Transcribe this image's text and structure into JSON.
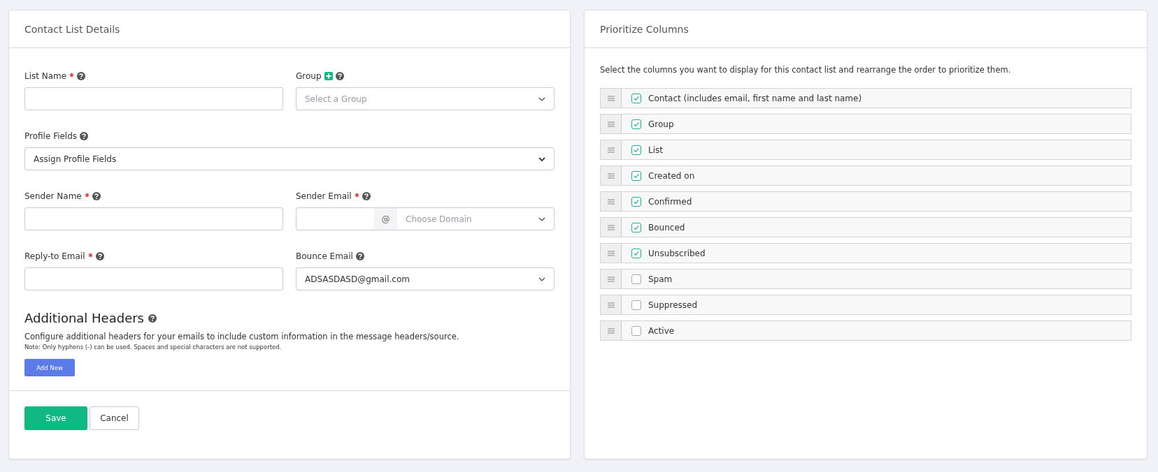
{
  "contact_list_details": {
    "title": "Contact List Details",
    "rows": [
      [
        {
          "label": "List Name",
          "required": true,
          "addable": false,
          "kind": "text"
        },
        {
          "label": "Group",
          "required": false,
          "addable": true,
          "kind": "select",
          "placeholder": "Select a Group"
        }
      ],
      [
        {
          "label": "Profile Fields",
          "required": false,
          "addable": false,
          "kind": "wide-select",
          "value": "Assign Profile Fields"
        }
      ],
      [
        {
          "label": "Sender Name",
          "required": true,
          "addable": false,
          "kind": "text"
        },
        {
          "label": "Sender Email",
          "required": true,
          "addable": false,
          "kind": "email-domain",
          "at": "@",
          "placeholder": "Choose Domain"
        }
      ],
      [
        {
          "label": "Reply-to Email",
          "required": true,
          "addable": false,
          "kind": "text"
        },
        {
          "label": "Bounce Email",
          "required": false,
          "addable": false,
          "kind": "select",
          "value": "ADSASDASD@gmail.com"
        }
      ]
    ],
    "additional_headers": {
      "title": "Additional Headers",
      "description": "Configure additional headers for your emails to include custom information in the message headers/source.",
      "note": "Note: Only hyphens (-) can be used. Spaces and special characters are not supported.",
      "button": "Add New"
    },
    "buttons": [
      {
        "label": "Save",
        "kind": "primary"
      },
      {
        "label": "Cancel",
        "kind": "secondary"
      }
    ]
  },
  "prioritize_columns": {
    "title": "Prioritize Columns",
    "instruction": "Select the columns you want to display for this contact list and rearrange the order to prioritize them.",
    "columns": [
      {
        "label": "Contact (includes email, first name and last name)",
        "checked": true
      },
      {
        "label": "Group",
        "checked": true
      },
      {
        "label": "List",
        "checked": true
      },
      {
        "label": "Created on",
        "checked": true
      },
      {
        "label": "Confirmed",
        "checked": true
      },
      {
        "label": "Bounced",
        "checked": true
      },
      {
        "label": "Unsubscribed",
        "checked": true
      },
      {
        "label": "Spam",
        "checked": false
      },
      {
        "label": "Suppressed",
        "checked": false
      },
      {
        "label": "Active",
        "checked": false
      }
    ]
  }
}
